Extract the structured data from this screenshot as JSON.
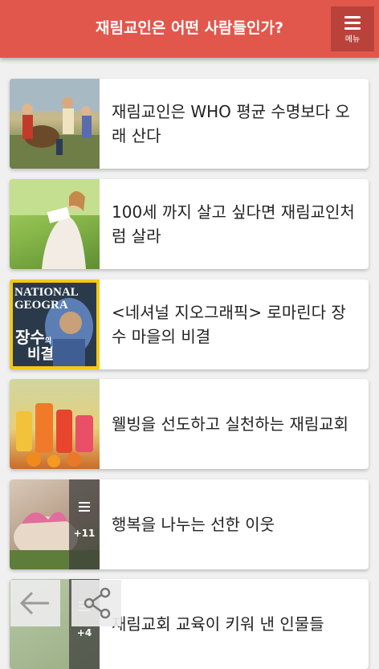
{
  "header": {
    "title": "재림교인은 어떤 사람들인가?",
    "menu_label": "메뉴"
  },
  "articles": [
    {
      "title": "재림교인은 WHO 평균 수명보다 오래 산다",
      "thumb": "family-picnic-photo"
    },
    {
      "title": "100세 까지 살고 싶다면 재림교인처럼 살라",
      "thumb": "woman-reading-photo"
    },
    {
      "title": "<네셔널 지오그래픽> 로마린다 장수 마을의 비결",
      "thumb": "magazine-cover",
      "cover_brand": "NATIONAL GEOGRA",
      "cover_headline": "장수",
      "cover_small": "의",
      "cover_sub": "비결"
    },
    {
      "title": "웰빙을 선도하고 실천하는 재림교회",
      "thumb": "juice-bottles-photo"
    },
    {
      "title": "행복을 나누는 선한 이웃",
      "thumb": "gift-basket-photo",
      "count": "+11"
    },
    {
      "title": "재림교회 교육이 키워 낸 인물들",
      "thumb": "people-photo",
      "count": "+4"
    }
  ],
  "floating": {
    "back_icon": "arrow-left-icon",
    "share_icon": "share-icon"
  },
  "colors": {
    "header_bg": "#e2574c",
    "menu_bg": "#b9423a",
    "page_bg": "#f0f0f0"
  }
}
